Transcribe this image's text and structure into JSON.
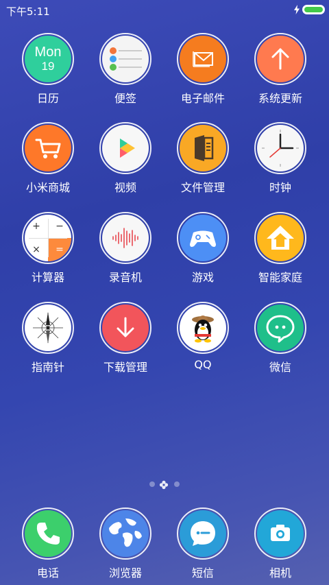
{
  "status_bar": {
    "time": "下午5:11",
    "battery_level_percent": 100,
    "charging": true
  },
  "colors": {
    "calendar": "#2fcf9c",
    "mail": "#f57c1f",
    "update": "#ff7a4f",
    "mall": "#fe7829",
    "files": "#f9a825",
    "game": "#4d8ff5",
    "home": "#ffb81c",
    "download": "#f2555b",
    "wechat": "#1fbf8a",
    "phone": "#3ccf6c",
    "browser": "#4d85e8",
    "sms": "#2b9cd8",
    "camera": "#22a7d8"
  },
  "calendar_icon": {
    "weekday": "Mon",
    "day": "19"
  },
  "calculator_icon": {
    "plus": "+",
    "minus": "−",
    "times": "×",
    "equals": "="
  },
  "apps": [
    {
      "label": "日历",
      "icon": "calendar-icon"
    },
    {
      "label": "便签",
      "icon": "notes-icon"
    },
    {
      "label": "电子邮件",
      "icon": "mail-icon"
    },
    {
      "label": "系统更新",
      "icon": "update-icon"
    },
    {
      "label": "小米商城",
      "icon": "cart-icon"
    },
    {
      "label": "视频",
      "icon": "video-play-icon"
    },
    {
      "label": "文件管理",
      "icon": "file-manager-icon"
    },
    {
      "label": "时钟",
      "icon": "clock-icon"
    },
    {
      "label": "计算器",
      "icon": "calculator-icon"
    },
    {
      "label": "录音机",
      "icon": "recorder-icon"
    },
    {
      "label": "游戏",
      "icon": "gamepad-icon"
    },
    {
      "label": "智能家庭",
      "icon": "smart-home-icon"
    },
    {
      "label": "指南针",
      "icon": "compass-icon"
    },
    {
      "label": "下载管理",
      "icon": "download-icon"
    },
    {
      "label": "QQ",
      "icon": "qq-icon"
    },
    {
      "label": "微信",
      "icon": "wechat-icon"
    }
  ],
  "dock": [
    {
      "label": "电话",
      "icon": "phone-icon"
    },
    {
      "label": "浏览器",
      "icon": "browser-globe-icon"
    },
    {
      "label": "短信",
      "icon": "sms-icon"
    },
    {
      "label": "相机",
      "icon": "camera-icon"
    }
  ],
  "pager": {
    "pages": 3,
    "current": 2
  }
}
